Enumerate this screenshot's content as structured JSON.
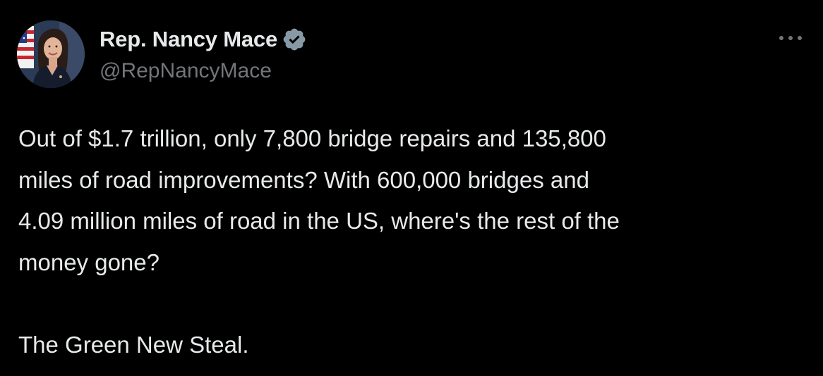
{
  "author": {
    "display_name": "Rep. Nancy Mace",
    "handle": "@RepNancyMace",
    "verified_color": "#8899a6",
    "avatar_icon": "profile-photo"
  },
  "more_icon": "ellipsis-icon",
  "tweet": {
    "lines": [
      "Out of $1.7 trillion, only 7,800 bridge repairs and 135,800",
      "miles of road improvements? With 600,000 bridges and",
      "4.09 million miles of road in the US, where's the rest of the",
      "money gone?"
    ],
    "closing": "The Green New Steal."
  },
  "colors": {
    "background": "#000000",
    "text": "#e7e9ea",
    "secondary": "#71767b"
  }
}
